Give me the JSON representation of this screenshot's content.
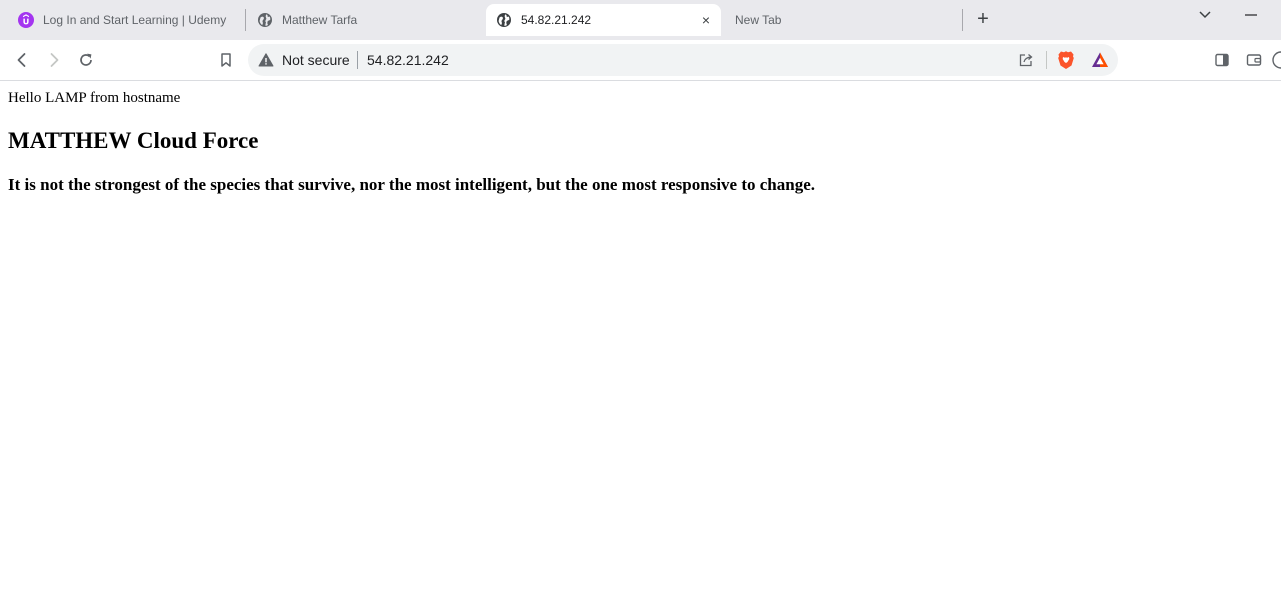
{
  "tabs": [
    {
      "title": "Log In and Start Learning | Udemy",
      "favicon": "udemy-icon",
      "active": false
    },
    {
      "title": "Matthew Tarfa",
      "favicon": "globe-icon",
      "active": false
    },
    {
      "title": "54.82.21.242",
      "favicon": "globe-icon",
      "active": true
    },
    {
      "title": "New Tab",
      "favicon": "",
      "active": false
    }
  ],
  "tab_controls": {
    "close": "×",
    "new_tab": "+"
  },
  "toolbar": {
    "security_label": "Not secure",
    "url": "54.82.21.242",
    "icons": [
      "back-icon",
      "forward-icon",
      "reload-icon",
      "bookmark-icon",
      "share-icon",
      "brave-shields-icon",
      "brave-rewards-icon",
      "sidebar-icon",
      "wallet-icon"
    ]
  },
  "page": {
    "hello_text": "Hello LAMP from hostname",
    "heading": "MATTHEW Cloud Force",
    "quote": "It is not the strongest of the species that survive, nor the most intelligent, but the one most responsive to change."
  },
  "colors": {
    "tabstrip_bg": "#e9e9ed",
    "udemy_purple": "#a435f0",
    "brave_orange": "#fb542b",
    "omnibox_bg": "#f1f3f4"
  }
}
